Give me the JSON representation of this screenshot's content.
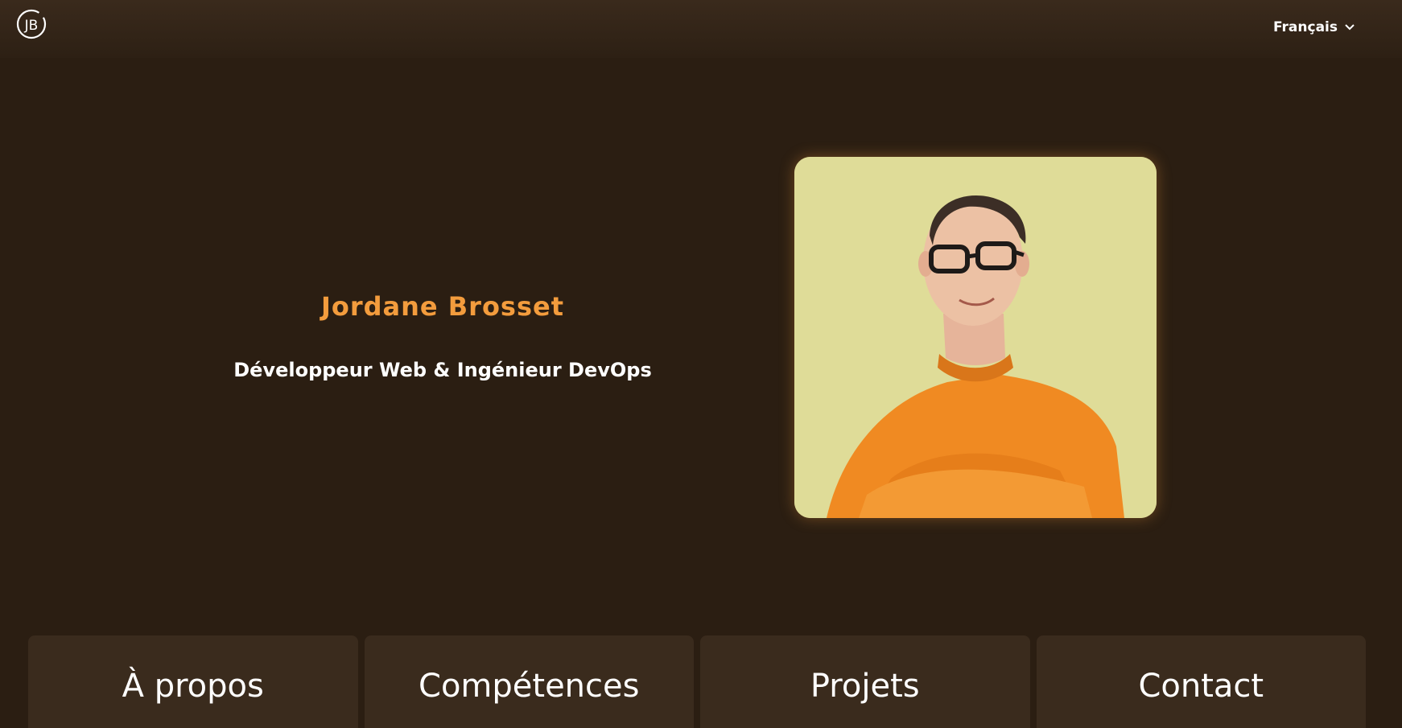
{
  "header": {
    "logo_text": "JB",
    "language": "Français",
    "language_icon": "chevron-down-icon"
  },
  "hero": {
    "name": "Jordane Brosset",
    "subtitle": "Développeur Web & Ingénieur DevOps"
  },
  "nav_cards": [
    {
      "label": "À propos"
    },
    {
      "label": "Compétences"
    },
    {
      "label": "Projets"
    },
    {
      "label": "Contact"
    }
  ],
  "colors": {
    "background": "#2b1e12",
    "accent": "#f39c3d",
    "card": "#3a2b1d"
  }
}
